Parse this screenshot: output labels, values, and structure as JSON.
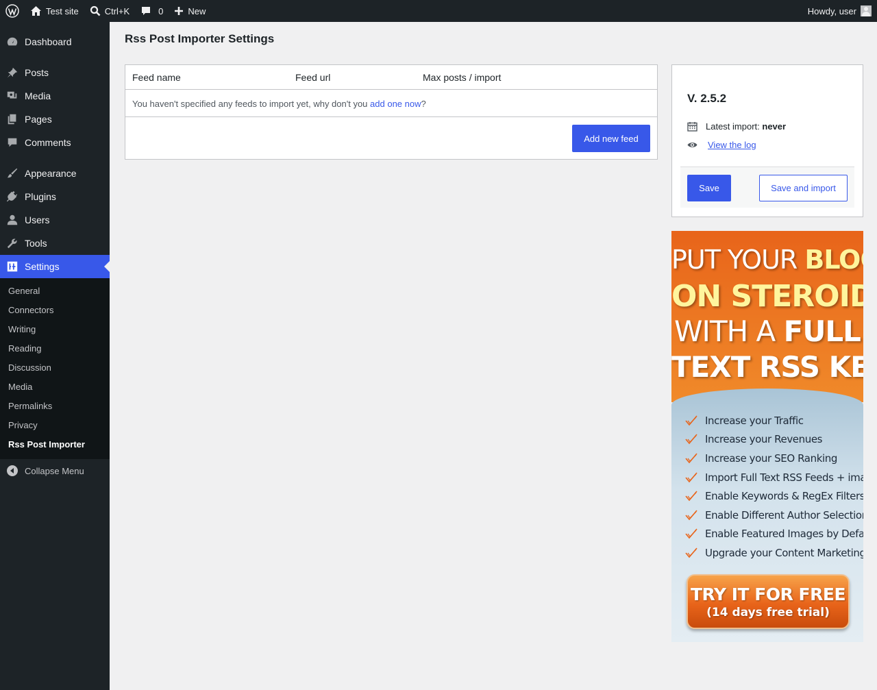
{
  "adminbar": {
    "site_name": "Test site",
    "search_shortcut": "Ctrl+K",
    "comments_count": "0",
    "new_label": "New",
    "greeting": "Howdy, user"
  },
  "sidebar": {
    "items": [
      {
        "label": "Dashboard",
        "icon": "dashboard-icon"
      },
      {
        "label": "Posts",
        "icon": "pin-icon"
      },
      {
        "label": "Media",
        "icon": "media-icon"
      },
      {
        "label": "Pages",
        "icon": "pages-icon"
      },
      {
        "label": "Comments",
        "icon": "comment-icon"
      },
      {
        "label": "Appearance",
        "icon": "brush-icon"
      },
      {
        "label": "Plugins",
        "icon": "plug-icon"
      },
      {
        "label": "Users",
        "icon": "user-icon"
      },
      {
        "label": "Tools",
        "icon": "wrench-icon"
      },
      {
        "label": "Settings",
        "icon": "settings-icon"
      }
    ],
    "submenu": [
      "General",
      "Connectors",
      "Writing",
      "Reading",
      "Discussion",
      "Media",
      "Permalinks",
      "Privacy",
      "Rss Post Importer"
    ],
    "collapse_label": "Collapse Menu"
  },
  "main": {
    "title": "Rss Post Importer Settings",
    "feeds": {
      "columns": [
        "Feed name",
        "Feed url",
        "Max posts / import"
      ],
      "empty_text": "You haven't specified any feeds to import yet, why don't you ",
      "empty_link": "add one now",
      "empty_suffix": "?",
      "add_button": "Add new feed"
    },
    "side": {
      "version": "V. 2.5.2",
      "latest_import_label": "Latest import:",
      "latest_import_value": "never",
      "view_log": "View the log",
      "save_button": "Save",
      "save_import_button": "Save and import"
    },
    "promo": {
      "line1_a": "PUT YOUR ",
      "line1_b": "BLOG",
      "line2": "ON STEROIDS",
      "line3_a": "WITH A ",
      "line3_b": "FULL",
      "line4": "TEXT RSS KEY",
      "features": [
        "Increase your Traffic",
        "Increase your Revenues",
        "Increase your SEO Ranking",
        "Import Full Text RSS Feeds + images",
        "Enable Keywords & RegEx Filters",
        "Enable Different Author Selection",
        "Enable Featured Images by Default",
        "Upgrade your Content Marketing"
      ],
      "cta_main": "TRY IT FOR FREE",
      "cta_sub": "(14 days free trial)"
    }
  },
  "colors": {
    "accent": "#3858e9",
    "adminbar_bg": "#1d2327",
    "submenu_bg": "#101517",
    "page_bg": "#f0f0f1",
    "promo_orange": "#e8641a"
  }
}
